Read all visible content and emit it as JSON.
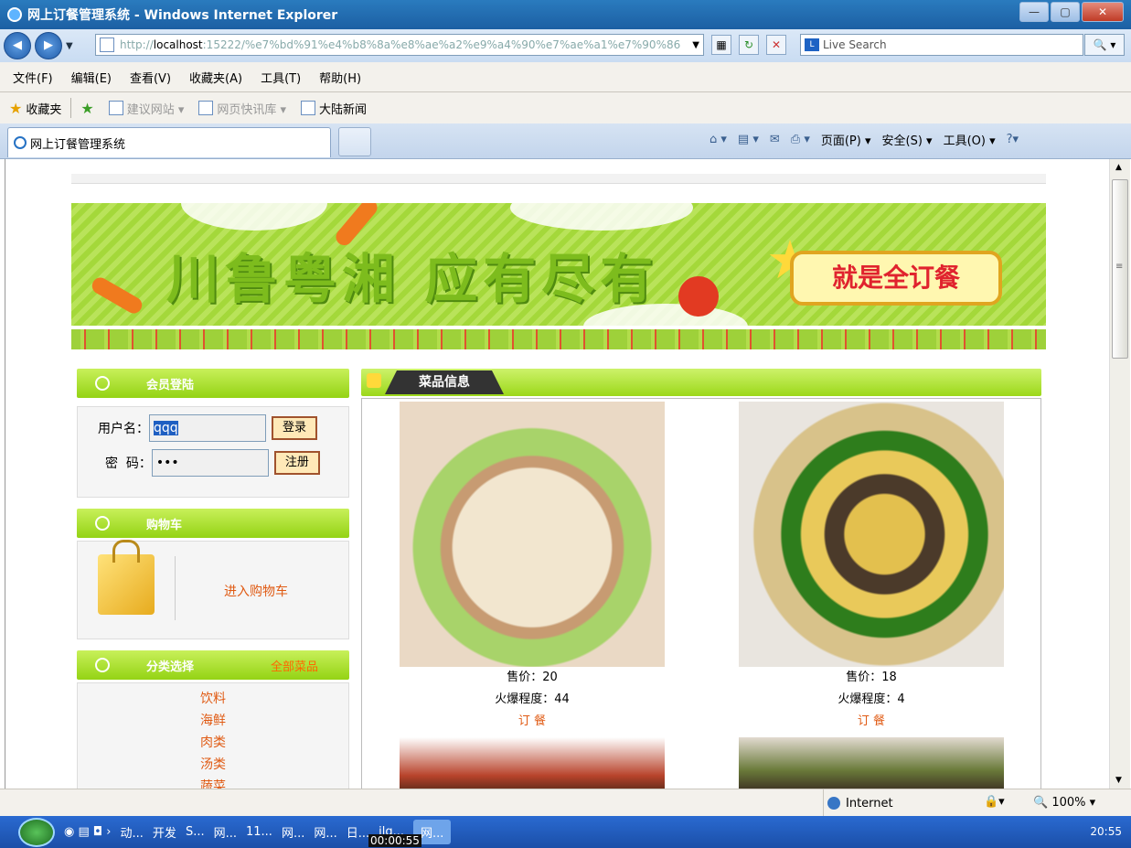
{
  "window": {
    "title": "网上订餐管理系统 - Windows Internet Explorer"
  },
  "address": {
    "url_prefix": "http://",
    "host": "localhost",
    "url_rest": ":15222/%e7%bd%91%e4%b8%8a%e8%ae%a2%e9%a4%90%e7%ae%a1%e7%90%86",
    "search_placeholder": "Live Search"
  },
  "menu": [
    "文件(F)",
    "编辑(E)",
    "查看(V)",
    "收藏夹(A)",
    "工具(T)",
    "帮助(H)"
  ],
  "favorites": {
    "label": "收藏夹",
    "links": [
      "建议网站 ▾",
      "网页快讯库 ▾",
      "大陆新闻"
    ]
  },
  "tab": {
    "title": "网上订餐管理系统"
  },
  "commands": {
    "page": "页面(P) ▾",
    "safety": "安全(S) ▾",
    "tools": "工具(O) ▾"
  },
  "banner": {
    "slogan": "川鲁粤湘 应有尽有",
    "tag": "就是全订餐"
  },
  "login": {
    "header": "会员登陆",
    "username_label": "用户名：",
    "username_value": "qqq",
    "password_label": "密  码：",
    "password_value": "•••",
    "login_button": "登录",
    "register_button": "注册"
  },
  "cart": {
    "header": "购物车",
    "link": "进入购物车"
  },
  "categories": {
    "header": "分类选择",
    "all_link": "全部菜品",
    "items": [
      "饮料",
      "海鲜",
      "肉类",
      "汤类",
      "蔬菜"
    ]
  },
  "dishes": {
    "header": "菜品信息",
    "items": [
      {
        "price": "售价：20",
        "popularity": "火爆程度：44",
        "order": "订 餐"
      },
      {
        "price": "售价：18",
        "popularity": "火爆程度：4",
        "order": "订 餐"
      }
    ]
  },
  "status": {
    "zone": "Internet",
    "zoom": "100%"
  },
  "taskbar": {
    "items": [
      "动...",
      "开发",
      "S...",
      "网...",
      "11...",
      "网...",
      "网...",
      "日...",
      "jlg...",
      "网..."
    ],
    "timer": "00:00:55",
    "clock": "20:55"
  }
}
